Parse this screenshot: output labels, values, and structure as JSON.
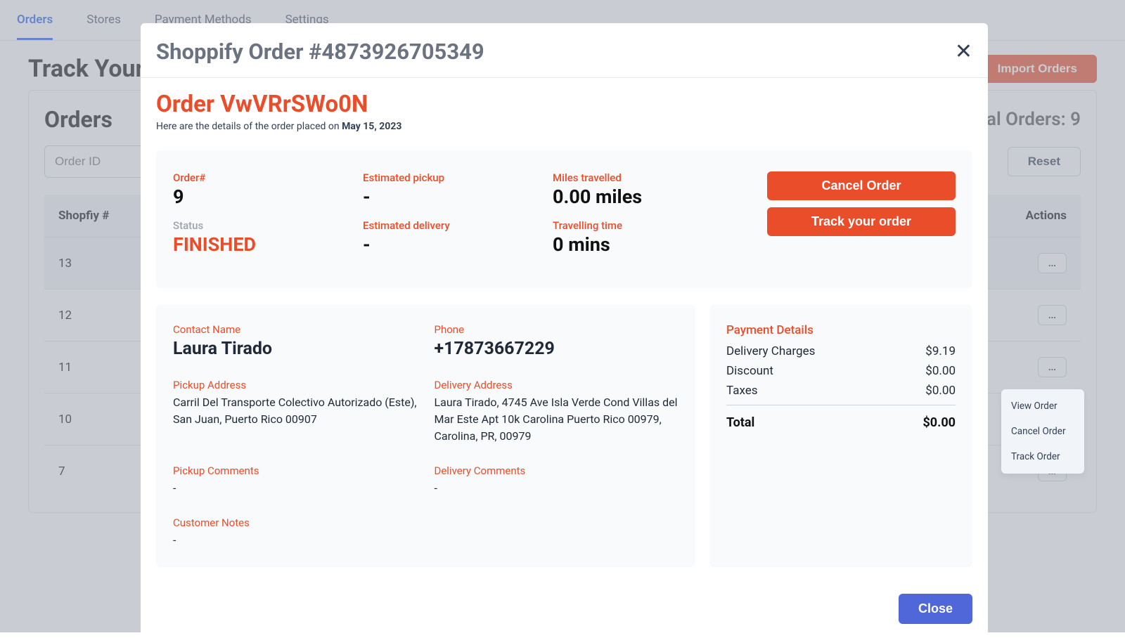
{
  "nav": {
    "tabs": [
      "Orders",
      "Stores",
      "Payment Methods",
      "Settings"
    ],
    "active": 0
  },
  "page": {
    "title": "Track Your",
    "import_btn": "Import Orders",
    "orders_title": "Orders",
    "total_label": "Total Orders:",
    "total_count": "9",
    "search_placeholder_orderid": "Order ID",
    "reset_btn": "Reset",
    "table": {
      "col1": "Shopfiy #",
      "col2": "Actions",
      "rows": [
        "13",
        "12",
        "11",
        "10",
        "7"
      ]
    }
  },
  "context_menu": {
    "items": [
      "View Order",
      "Cancel Order",
      "Track Order"
    ]
  },
  "modal": {
    "title": "Shoppify Order #4873926705349",
    "order_title": "Order VwVRrSWo0N",
    "sub_prefix": "Here are the details of the order placed on ",
    "sub_date": "May 15, 2023",
    "summary": {
      "order_num_label": "Order#",
      "order_num": "9",
      "status_label": "Status",
      "status": "FINISHED",
      "pickup_label": "Estimated pickup",
      "pickup": "-",
      "delivery_label": "Estimated delivery",
      "delivery": "-",
      "miles_label": "Miles travelled",
      "miles": "0.00 miles",
      "time_label": "Travelling time",
      "time": "0 mins",
      "cancel_btn": "Cancel Order",
      "track_btn": "Track your order"
    },
    "contact": {
      "name_label": "Contact Name",
      "name": "Laura Tirado",
      "phone_label": "Phone",
      "phone": "+17873667229",
      "pickup_addr_label": "Pickup Address",
      "pickup_addr": "Carril Del Transporte Colectivo Autorizado (Este), San Juan, Puerto Rico 00907",
      "delivery_addr_label": "Delivery Address",
      "delivery_addr": "Laura Tirado, 4745 Ave Isla Verde Cond Villas del Mar Este Apt 10k Carolina Puerto Rico 00979, Carolina, PR, 00979",
      "pickup_comments_label": "Pickup Comments",
      "pickup_comments": "-",
      "delivery_comments_label": "Delivery Comments",
      "delivery_comments": "-",
      "notes_label": "Customer Notes",
      "notes": "-"
    },
    "payment": {
      "title": "Payment Details",
      "rows": [
        {
          "label": "Delivery Charges",
          "value": "$9.19"
        },
        {
          "label": "Discount",
          "value": "$0.00"
        },
        {
          "label": "Taxes",
          "value": "$0.00"
        }
      ],
      "total_label": "Total",
      "total_value": "$0.00"
    },
    "close_btn": "Close"
  }
}
